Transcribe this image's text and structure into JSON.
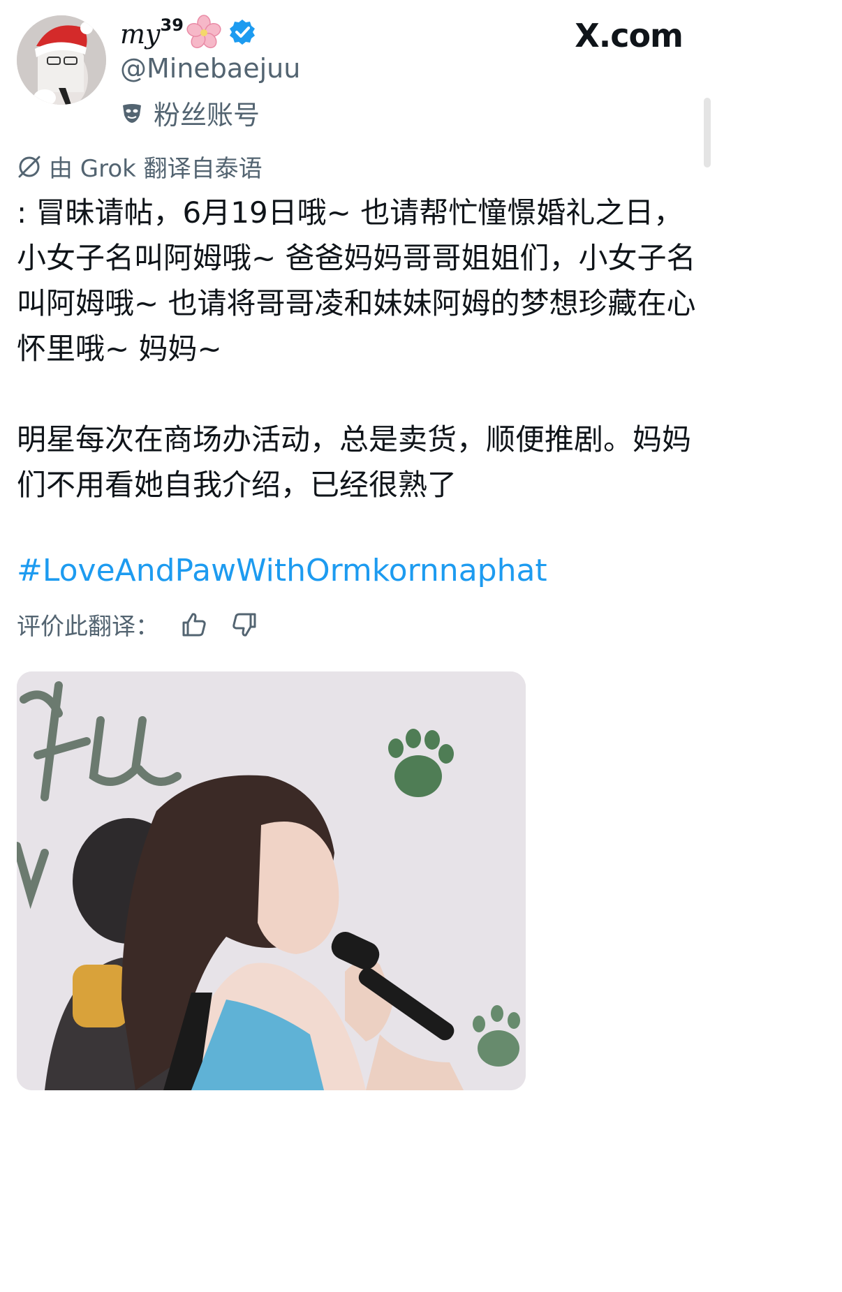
{
  "user": {
    "display_name": "my",
    "display_name_superscript": "39",
    "handle": "@Minebaejuu",
    "account_label": "粉丝账号"
  },
  "brand": "X.com",
  "translation": {
    "note": "由 Grok 翻译自泰语",
    "rate_label": "评价此翻译："
  },
  "post": {
    "paragraph1": ": 冒昧请帖，6月19日哦~ 也请帮忙憧憬婚礼之日，小女子名叫阿姆哦~ 爸爸妈妈哥哥姐姐们，小女子名叫阿姆哦~ 也请将哥哥凌和妹妹阿姆的梦想珍藏在心怀里哦~ 妈妈~",
    "paragraph2": "明星每次在商场办活动，总是卖货，顺便推剧。妈妈们不用看她自我介绍，已经很熟了",
    "hashtag": "#LoveAndPawWithOrmkornnaphat"
  },
  "icons": {
    "verified": "verified-badge-icon",
    "account_label": "mask-icon",
    "translation": "grok-icon",
    "thumbs_up": "thumbs-up-icon",
    "thumbs_down": "thumbs-down-icon"
  },
  "colors": {
    "link": "#1d9bf0",
    "verified": "#1d9bf0",
    "secondary_text": "#536471"
  }
}
